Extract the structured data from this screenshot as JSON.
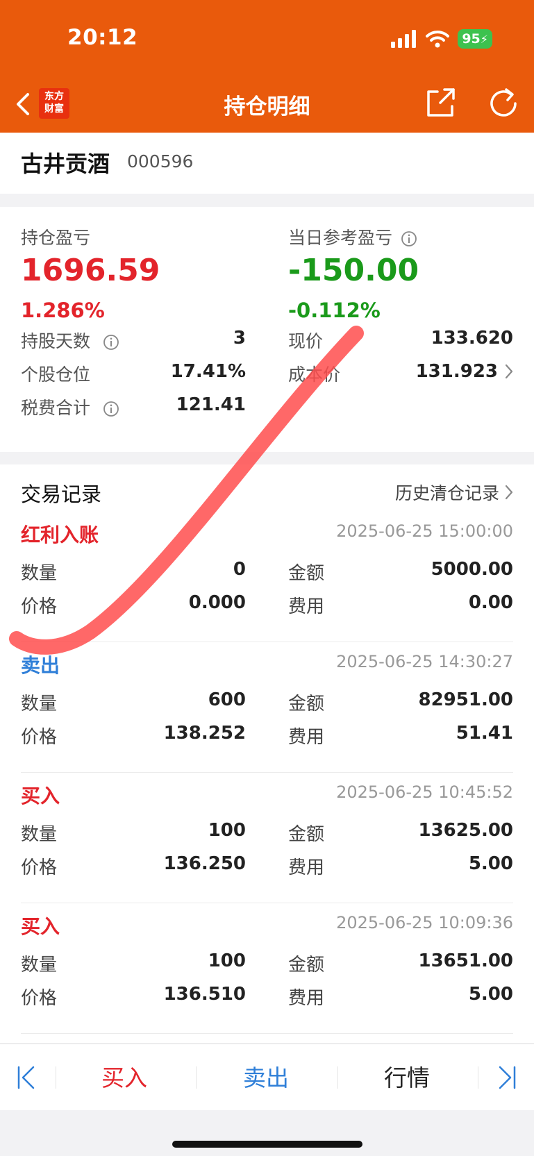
{
  "status_bar": {
    "time": "20:12",
    "battery": "95"
  },
  "nav": {
    "logo_line1": "东方",
    "logo_line2": "财富",
    "title": "持仓明细"
  },
  "stock": {
    "name": "古井贡酒",
    "code": "000596"
  },
  "pnl": {
    "position_label": "持仓盈亏",
    "position_value": "1696.59",
    "position_pct": "1.286%",
    "daily_label": "当日参考盈亏",
    "daily_value": "-150.00",
    "daily_pct": "-0.112%",
    "stats": {
      "days_label": "持股天数",
      "days_value": "3",
      "weight_label": "个股仓位",
      "weight_value": "17.41%",
      "fees_label": "税费合计",
      "fees_value": "121.41",
      "price_label": "现价",
      "price_value": "133.620",
      "cost_label": "成本价",
      "cost_value": "131.923"
    }
  },
  "trades": {
    "title": "交易记录",
    "history_link": "历史清仓记录",
    "records": [
      {
        "type": "红利入账",
        "time": "2025-06-25 15:00:00",
        "qty_label": "数量",
        "qty": "0",
        "amount_label": "金额",
        "amount": "5000.00",
        "price_label": "价格",
        "price": "0.000",
        "fee_label": "费用",
        "fee": "0.00"
      },
      {
        "type": "卖出",
        "time": "2025-06-25 14:30:27",
        "qty_label": "数量",
        "qty": "600",
        "amount_label": "金额",
        "amount": "82951.00",
        "price_label": "价格",
        "price": "138.252",
        "fee_label": "费用",
        "fee": "51.41"
      },
      {
        "type": "买入",
        "time": "2025-06-25 10:45:52",
        "qty_label": "数量",
        "qty": "100",
        "amount_label": "金额",
        "amount": "13625.00",
        "price_label": "价格",
        "price": "136.250",
        "fee_label": "费用",
        "fee": "5.00"
      },
      {
        "type": "买入",
        "time": "2025-06-25 10:09:36",
        "qty_label": "数量",
        "qty": "100",
        "amount_label": "金额",
        "amount": "13651.00",
        "price_label": "价格",
        "price": "136.510",
        "fee_label": "费用",
        "fee": "5.00"
      }
    ]
  },
  "bottom_bar": {
    "buy": "买入",
    "sell": "卖出",
    "market": "行情"
  },
  "colors": {
    "header": "#e95a0c",
    "profit": "#e3242b",
    "loss": "#1a9a1a",
    "sell": "#2f7fd8",
    "scribble": "#ff4d4d"
  }
}
